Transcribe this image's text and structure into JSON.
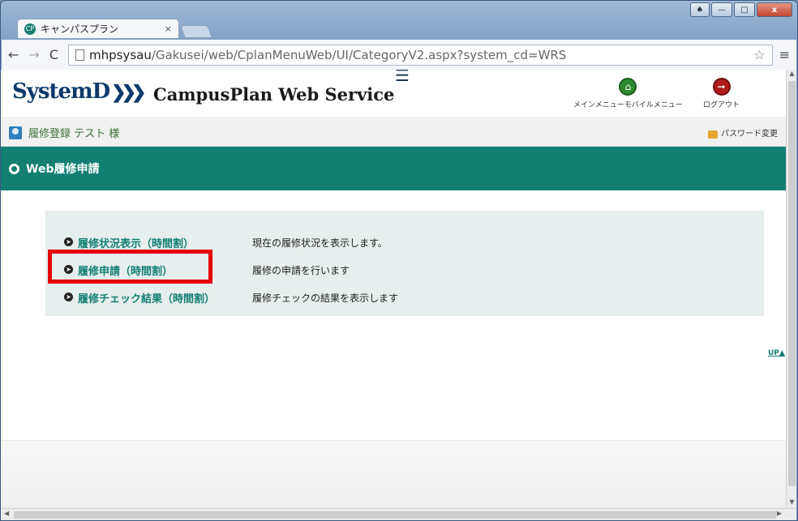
{
  "browser": {
    "tab_title": "キャンパスプラン",
    "tab_close": "×",
    "url_host": "mhpsysau",
    "url_path": "/Gakusei/web/CplanMenuWeb/UI/CategoryV2.aspx?system_cd=WRS",
    "back": "←",
    "forward": "→",
    "reload": "C",
    "star": "☆",
    "menu": "≡",
    "win_close": "x"
  },
  "header": {
    "logo_text": "SystemD",
    "site_title": "CampusPlan Web Service",
    "main_menu_label": "メインメニュー",
    "mobile_menu_label": "モバイルメニュー",
    "logout_label": "ログアウト"
  },
  "userbar": {
    "user_text": "履修登録 テスト 様",
    "password_label": "パスワード変更"
  },
  "section": {
    "title": "Web履修申請"
  },
  "menu": {
    "items": [
      {
        "label": "履修状況表示（時間割）",
        "desc": "現在の履修状況を表示します。"
      },
      {
        "label": "履修申請（時間割）",
        "desc": "履修の申請を行います"
      },
      {
        "label": "履修チェック結果（時間割）",
        "desc": "履修チェックの結果を表示します"
      }
    ]
  },
  "page": {
    "up_label": "UP"
  },
  "colors": {
    "brand_teal": "#127f72",
    "highlight_red": "#e60000"
  }
}
